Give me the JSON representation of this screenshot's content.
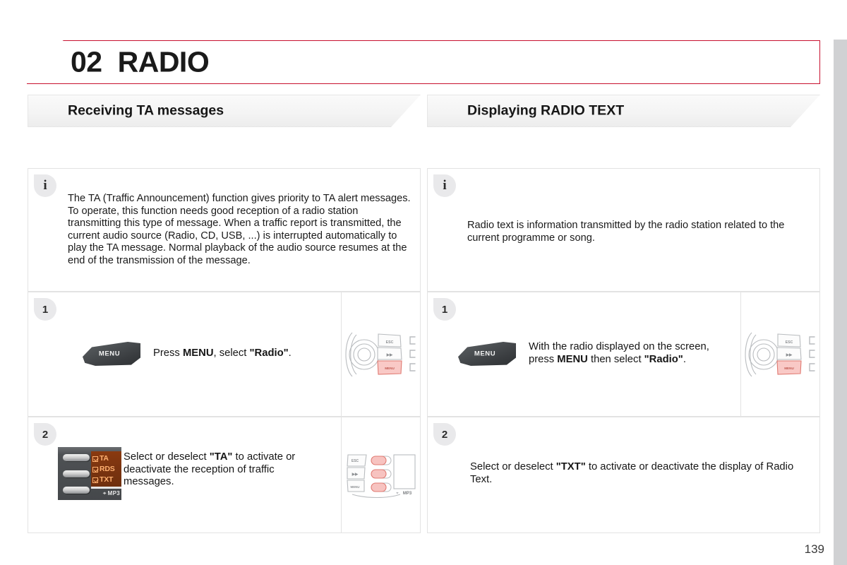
{
  "chapter": {
    "number": "02",
    "title": "RADIO",
    "accent_color": "#c8102e"
  },
  "page_number": "139",
  "columns": [
    {
      "header": "Receiving TA messages",
      "info": {
        "icon": "info-icon",
        "text": "The TA (Traffic Announcement) function gives priority to TA alert messages. To operate, this function needs good reception of a radio station transmitting this type of message. When a traffic report is transmitted, the current audio source (Radio, CD, USB, ...) is interrupted automatically to play the TA message. Normal playback of the audio source resumes at the end of the transmission of the message."
      },
      "steps": [
        {
          "number": "1",
          "graphic": "menu-wheel-button",
          "menu_label": "MENU",
          "text_html": "Press <b>MENU</b>, select <b>\"Radio\"</b>.",
          "thumbnail": "steering-wheel-controls-menu-highlighted"
        },
        {
          "number": "2",
          "graphic": "radio-head-unit-display",
          "display_items": [
            "TA",
            "RDS",
            "TXT"
          ],
          "display_footer": "MP3",
          "text_html": "Select or deselect <b>\"TA\"</b> to activate or deactivate the reception of traffic messages.",
          "thumbnail": "head-unit-side-buttons-highlighted"
        }
      ]
    },
    {
      "header": "Displaying RADIO TEXT",
      "info": {
        "icon": "info-icon",
        "text": "Radio text is information transmitted by the radio station related to the current programme or song."
      },
      "steps": [
        {
          "number": "1",
          "graphic": "menu-wheel-button",
          "menu_label": "MENU",
          "text_html": "With the radio displayed on the screen, press <b>MENU</b> then select <b>\"Radio\"</b>.",
          "thumbnail": "steering-wheel-controls-menu-highlighted"
        },
        {
          "number": "2",
          "graphic": "none",
          "text_html": "Select or deselect <b>\"TXT\"</b> to activate or deactivate the display of Radio Text.",
          "thumbnail": "none"
        }
      ]
    }
  ],
  "thumbnail_labels": {
    "esc": "ESC",
    "seek": "▶▶",
    "menu": "MENU",
    "mp3": "MP3"
  }
}
